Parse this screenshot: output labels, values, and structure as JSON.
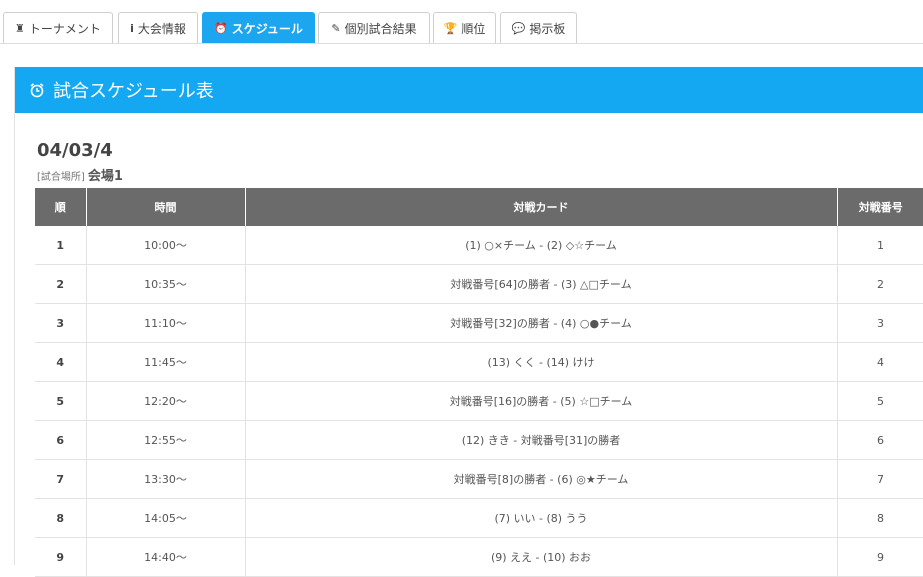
{
  "tabs": [
    {
      "icon": "♜",
      "label": "トーナメント"
    },
    {
      "icon": "i",
      "label": "大会情報"
    },
    {
      "icon": "⏰",
      "label": "スケジュール",
      "active": true
    },
    {
      "icon": "✎",
      "label": "個別試合結果"
    },
    {
      "icon": "🏆",
      "label": "順位"
    },
    {
      "icon": "💬",
      "label": "掲示板"
    }
  ],
  "panel": {
    "icon": "alarm-clock-icon",
    "title": "試合スケジュール表"
  },
  "date": "04/03/4",
  "venue": {
    "prefix": "[試合場所]",
    "name": "会場1"
  },
  "table": {
    "headers": [
      "順",
      "時間",
      "対戦カード",
      "対戦番号"
    ],
    "rows": [
      [
        "1",
        "10:00〜",
        "(1) ○×チーム - (2) ◇☆チーム",
        "1"
      ],
      [
        "2",
        "10:35〜",
        "対戦番号[64]の勝者 - (3) △□チーム",
        "2"
      ],
      [
        "3",
        "11:10〜",
        "対戦番号[32]の勝者 - (4) ○●チーム",
        "3"
      ],
      [
        "4",
        "11:45〜",
        "(13) くく - (14) けけ",
        "4"
      ],
      [
        "5",
        "12:20〜",
        "対戦番号[16]の勝者 - (5) ☆□チーム",
        "5"
      ],
      [
        "6",
        "12:55〜",
        "(12) きき - 対戦番号[31]の勝者",
        "6"
      ],
      [
        "7",
        "13:30〜",
        "対戦番号[8]の勝者 - (6) ◎★チーム",
        "7"
      ],
      [
        "8",
        "14:05〜",
        "(7) いい - (8) うう",
        "8"
      ],
      [
        "9",
        "14:40〜",
        "(9) ええ - (10) おお",
        "9"
      ]
    ]
  }
}
